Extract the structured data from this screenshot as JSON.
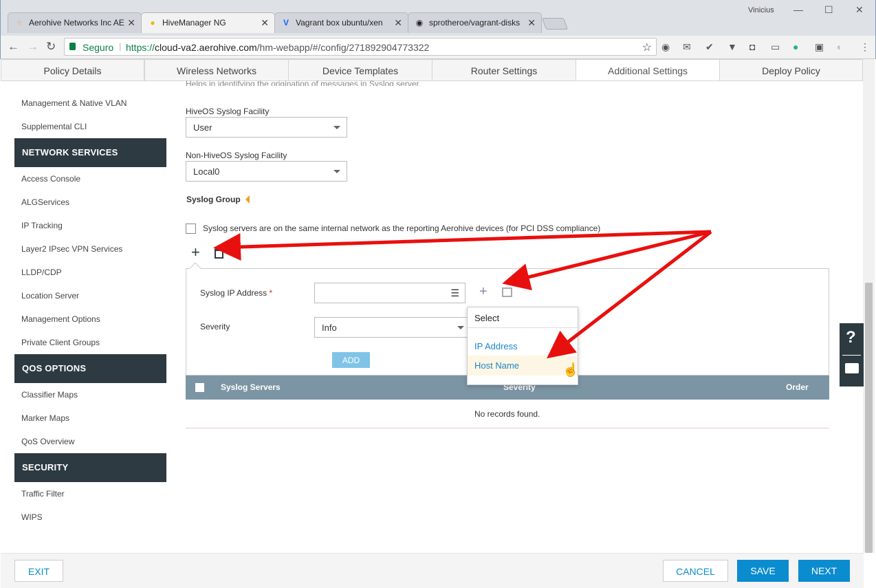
{
  "browser": {
    "tabs": [
      {
        "label": "Aerohive Networks Inc AE",
        "icon": "aerohive-icon"
      },
      {
        "label": "HiveManager NG",
        "icon": "hivemanager-icon"
      },
      {
        "label": "Vagrant box ubuntu/xen",
        "icon": "vagrant-icon"
      },
      {
        "label": "sprotheroe/vagrant-disks",
        "icon": "github-icon"
      }
    ],
    "user": "Vinicius",
    "secure_label": "Seguro",
    "url_scheme": "https://",
    "url_host": "cloud-va2.aerohive.com",
    "url_path": "/hm-webapp/#/config/271892904773322"
  },
  "config_tabs": [
    "Policy Details",
    "Wireless Networks",
    "Device Templates",
    "Router Settings",
    "Additional Settings",
    "Deploy Policy"
  ],
  "sidebar": {
    "items_top": [
      "Management & Native VLAN",
      "Supplemental CLI"
    ],
    "sections": [
      {
        "title": "NETWORK SERVICES",
        "items": [
          "Access Console",
          "ALGServices",
          "IP Tracking",
          "Layer2 IPsec VPN Services",
          "LLDP/CDP",
          "Location Server",
          "Management Options",
          "Private Client Groups"
        ]
      },
      {
        "title": "QOS OPTIONS",
        "items": [
          "Classifier Maps",
          "Marker Maps",
          "QoS Overview"
        ]
      },
      {
        "title": "SECURITY",
        "items": [
          "Traffic Filter",
          "WIPS"
        ]
      }
    ]
  },
  "main": {
    "cut_text": "Helps in identifying the origination of messages in Syslog server.",
    "hiveos_facility_label": "HiveOS Syslog Facility",
    "hiveos_facility_value": "User",
    "nonhiveos_facility_label": "Non-HiveOS Syslog Facility",
    "nonhiveos_facility_value": "Local0",
    "syslog_group_label": "Syslog Group",
    "pci_checkbox_label": "Syslog servers are on the same internal network as the reporting Aerohive devices (for PCI DSS compliance)",
    "ip_label": "Syslog IP Address",
    "required_mark": "*",
    "severity_label": "Severity",
    "severity_value": "Info",
    "add_button": "ADD",
    "dropdown": {
      "header": "Select",
      "options": [
        "IP Address",
        "Host Name"
      ]
    },
    "table": {
      "columns": [
        "Syslog Servers",
        "Severity",
        "Order"
      ],
      "empty": "No records found."
    }
  },
  "footer": {
    "exit": "EXIT",
    "cancel": "CANCEL",
    "save": "SAVE",
    "next": "NEXT"
  },
  "colors": {
    "dark": "#2d3a41",
    "blue": "#0b8ccf",
    "link": "#1a86c8",
    "table_header": "#7b95a4",
    "arrow": "#e8100e"
  }
}
